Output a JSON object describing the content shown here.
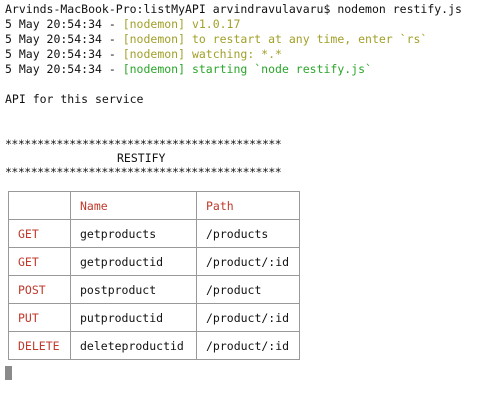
{
  "terminal": {
    "prompt_line": "Arvinds-MacBook-Pro:listMyAPI arvindravulavaru$ nodemon restify.js",
    "log_lines": [
      {
        "timestamp": "5 May 20:54:34 - ",
        "message": "[nodemon] v1.0.17",
        "color": "#a2a02a"
      },
      {
        "timestamp": "5 May 20:54:34 - ",
        "message": "[nodemon] to restart at any time, enter `rs`",
        "color": "#a2a02a"
      },
      {
        "timestamp": "5 May 20:54:34 - ",
        "message": "[nodemon] watching: *.*",
        "color": "#a2a02a"
      },
      {
        "timestamp": "5 May 20:54:34 - ",
        "message": "[nodemon] starting `node restify.js`",
        "color": "#2aa62a"
      }
    ],
    "api_heading": "API for this service",
    "banner_stars": "*******************************************",
    "banner_title": "RESTIFY"
  },
  "routes_table": {
    "headers": [
      "",
      "Name",
      "Path"
    ],
    "rows": [
      {
        "method": "GET",
        "name": "getproducts",
        "path": "/products"
      },
      {
        "method": "GET",
        "name": "getproductid",
        "path": "/product/:id"
      },
      {
        "method": "POST",
        "name": "postproduct",
        "path": "/product"
      },
      {
        "method": "PUT",
        "name": "putproductid",
        "path": "/product/:id"
      },
      {
        "method": "DELETE",
        "name": "deleteproductid",
        "path": "/product/:id"
      }
    ]
  },
  "colors": {
    "nodemon_info": "#a2a02a",
    "nodemon_start": "#2aa62a",
    "table_accent": "#c0392b",
    "cursor": "#8a8a8a"
  }
}
